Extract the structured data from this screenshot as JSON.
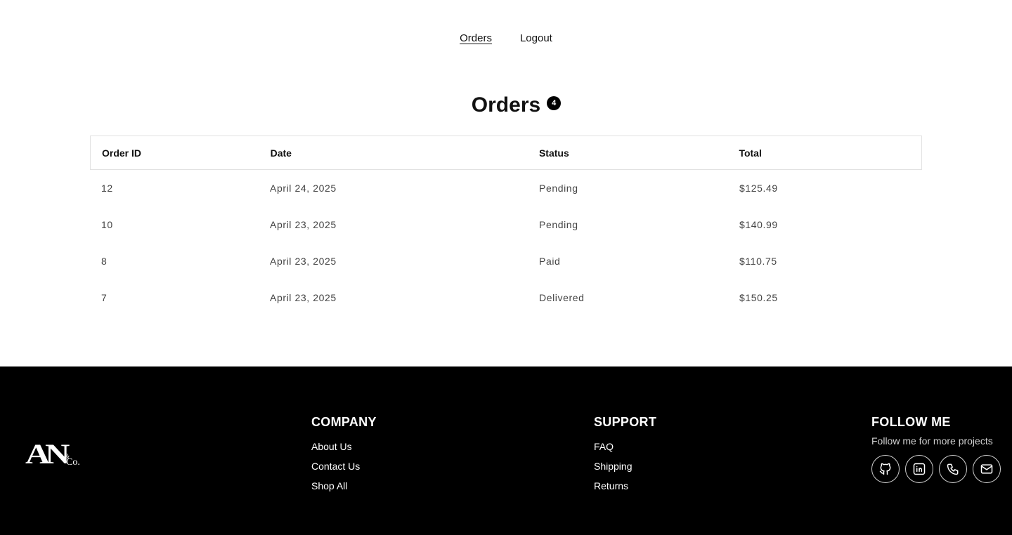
{
  "nav": {
    "orders_label": "Orders",
    "logout_label": "Logout"
  },
  "page": {
    "title": "Orders",
    "count": "4"
  },
  "table": {
    "headers": [
      "Order ID",
      "Date",
      "Status",
      "Total"
    ],
    "rows": [
      [
        "12",
        "April 24, 2025",
        "Pending",
        "$125.49"
      ],
      [
        "10",
        "April 23, 2025",
        "Pending",
        "$140.99"
      ],
      [
        "8",
        "April 23, 2025",
        "Paid",
        "$110.75"
      ],
      [
        "7",
        "April 23, 2025",
        "Delivered",
        "$150.25"
      ]
    ]
  },
  "footer": {
    "logo_text": "AN&Co.",
    "company": {
      "heading": "COMPANY",
      "links": [
        "About Us",
        "Contact Us",
        "Shop All"
      ]
    },
    "support": {
      "heading": "SUPPORT",
      "links": [
        "FAQ",
        "Shipping",
        "Returns"
      ]
    },
    "follow": {
      "heading": "FOLLOW ME",
      "text": "Follow me for more projects",
      "icons": [
        "github-icon",
        "linkedin-icon",
        "phone-icon",
        "mail-icon"
      ]
    }
  },
  "colors": {
    "footer_bg": "#000000",
    "text": "#111111",
    "muted": "#444444",
    "border": "#e2e2e2"
  }
}
